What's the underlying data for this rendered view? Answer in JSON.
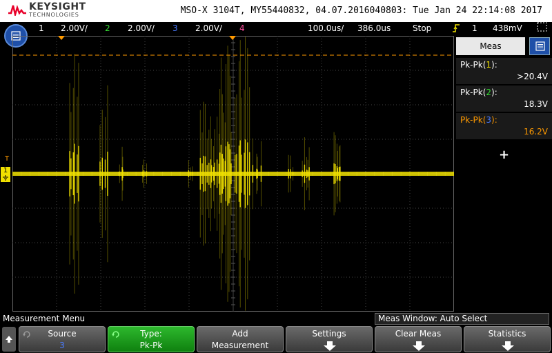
{
  "header": {
    "brand": "KEYSIGHT",
    "brand_sub": "TECHNOLOGIES",
    "model_info": "MSO-X 3104T, MY55440832, 04.07.2016040803: Tue Jan 24 22:14:08 2017"
  },
  "status": {
    "ch1_num": "1",
    "ch1_scale": "2.00V/",
    "ch2_num": "2",
    "ch2_scale": "2.00V/",
    "ch3_num": "3",
    "ch3_scale": "2.00V/",
    "ch4_num": "4",
    "timebase": "100.0us/",
    "delay": "386.0us",
    "run_state": "Stop",
    "trig_channel": "1",
    "trig_level": "438mV"
  },
  "colors": {
    "ch1": "#f0e000",
    "ch2": "#33dd33",
    "ch3": "#4a7bff",
    "ch4": "#ff4fa0",
    "meas3": "#ff9a00",
    "trigger_marker": "#ff9a00",
    "menu_blue": "#1e4fa8",
    "softkey_active": "#1a9a1a"
  },
  "side_panel": {
    "title": "Meas",
    "measurements": [
      {
        "label_prefix": "Pk-Pk(",
        "channel": "1",
        "label_suffix": "):",
        "value": ">20.4V"
      },
      {
        "label_prefix": "Pk-Pk(",
        "channel": "2",
        "label_suffix": "):",
        "value": "18.3V"
      },
      {
        "label_prefix": "Pk-Pk(",
        "channel": "3",
        "label_suffix": "):",
        "value": "16.2V"
      }
    ],
    "add_symbol": "+"
  },
  "scope": {
    "trigger_label": "T",
    "ch1_ground_label": "1"
  },
  "bottom": {
    "menu_title": "Measurement Menu",
    "meas_window": "Meas Window: Auto Select"
  },
  "softkeys": [
    {
      "l1": "Source",
      "l2": "3"
    },
    {
      "l1": "Type:",
      "l2": "Pk-Pk"
    },
    {
      "l1": "Add",
      "l2": "Measurement"
    },
    {
      "l1": "Settings",
      "l2": ""
    },
    {
      "l1": "Clear Meas",
      "l2": ""
    },
    {
      "l1": "Statistics",
      "l2": ""
    }
  ]
}
